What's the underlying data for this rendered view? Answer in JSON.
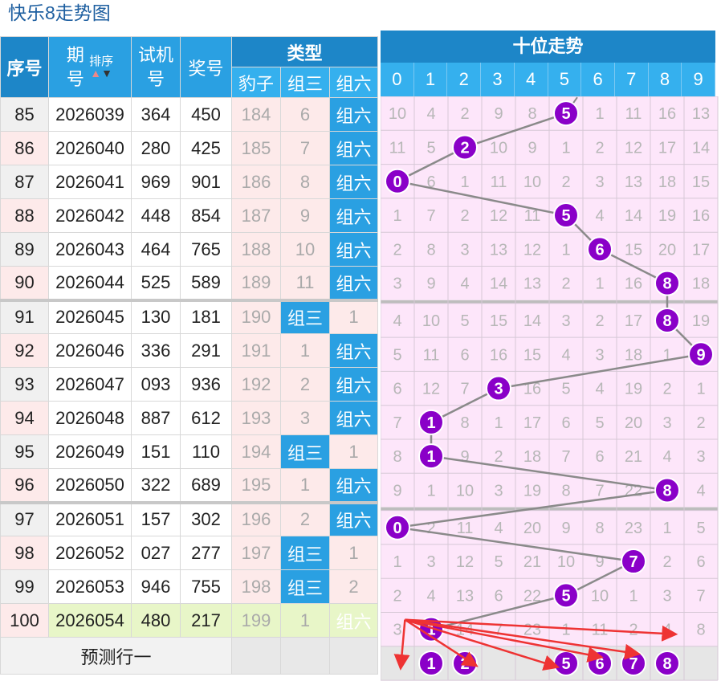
{
  "page": {
    "title": "快乐8走势图"
  },
  "left": {
    "headers": {
      "seq": "序号",
      "issue_a": "期",
      "issue_b": "号",
      "sort_label": "排序",
      "trial_a": "试机",
      "trial_b": "号",
      "prize": "奖号",
      "type": "类型",
      "leopard": "豹子",
      "group3": "组三",
      "group6": "组六"
    },
    "rows": [
      {
        "seq": "85",
        "issue": "2026039",
        "trial": "364",
        "prize": "450",
        "leopard": "184",
        "g3": "6",
        "g6": "组六",
        "tag": "g6",
        "sep": false
      },
      {
        "seq": "86",
        "issue": "2026040",
        "trial": "280",
        "prize": "425",
        "leopard": "185",
        "g3": "7",
        "g6": "组六",
        "tag": "g6",
        "sep": false
      },
      {
        "seq": "87",
        "issue": "2026041",
        "trial": "969",
        "prize": "901",
        "leopard": "186",
        "g3": "8",
        "g6": "组六",
        "tag": "g6",
        "sep": false
      },
      {
        "seq": "88",
        "issue": "2026042",
        "trial": "448",
        "prize": "854",
        "leopard": "187",
        "g3": "9",
        "g6": "组六",
        "tag": "g6",
        "sep": false
      },
      {
        "seq": "89",
        "issue": "2026043",
        "trial": "464",
        "prize": "765",
        "leopard": "188",
        "g3": "10",
        "g6": "组六",
        "tag": "g6",
        "sep": false
      },
      {
        "seq": "90",
        "issue": "2026044",
        "trial": "525",
        "prize": "589",
        "leopard": "189",
        "g3": "11",
        "g6": "组六",
        "tag": "g6",
        "sep": false
      },
      {
        "seq": "91",
        "issue": "2026045",
        "trial": "130",
        "prize": "181",
        "leopard": "190",
        "g3": "组三",
        "g6": "1",
        "tag": "g3",
        "sep": true
      },
      {
        "seq": "92",
        "issue": "2026046",
        "trial": "336",
        "prize": "291",
        "leopard": "191",
        "g3": "1",
        "g6": "组六",
        "tag": "g6",
        "sep": false
      },
      {
        "seq": "93",
        "issue": "2026047",
        "trial": "093",
        "prize": "936",
        "leopard": "192",
        "g3": "2",
        "g6": "组六",
        "tag": "g6",
        "sep": false
      },
      {
        "seq": "94",
        "issue": "2026048",
        "trial": "887",
        "prize": "612",
        "leopard": "193",
        "g3": "3",
        "g6": "组六",
        "tag": "g6",
        "sep": false
      },
      {
        "seq": "95",
        "issue": "2026049",
        "trial": "151",
        "prize": "110",
        "leopard": "194",
        "g3": "组三",
        "g6": "1",
        "tag": "g3",
        "sep": false
      },
      {
        "seq": "96",
        "issue": "2026050",
        "trial": "322",
        "prize": "689",
        "leopard": "195",
        "g3": "1",
        "g6": "组六",
        "tag": "g6",
        "sep": false
      },
      {
        "seq": "97",
        "issue": "2026051",
        "trial": "157",
        "prize": "302",
        "leopard": "196",
        "g3": "2",
        "g6": "组六",
        "tag": "g6",
        "sep": true
      },
      {
        "seq": "98",
        "issue": "2026052",
        "trial": "027",
        "prize": "277",
        "leopard": "197",
        "g3": "组三",
        "g6": "1",
        "tag": "g3",
        "sep": false
      },
      {
        "seq": "99",
        "issue": "2026053",
        "trial": "946",
        "prize": "755",
        "leopard": "198",
        "g3": "组三",
        "g6": "2",
        "tag": "g3",
        "sep": false
      },
      {
        "seq": "100",
        "issue": "2026054",
        "trial": "480",
        "prize": "217",
        "leopard": "199",
        "g3": "1",
        "g6": "组六",
        "tag": "g6",
        "sep": false
      }
    ],
    "predict_label": "预测行一"
  },
  "right": {
    "title": "十位走势",
    "columns": [
      "0",
      "1",
      "2",
      "3",
      "4",
      "5",
      "6",
      "7",
      "8",
      "9"
    ],
    "ball_color": "#8a00c8",
    "grid_rows": [
      [
        "10",
        "4",
        "2",
        "9",
        "8",
        "5",
        "1",
        "11",
        "16",
        "13"
      ],
      [
        "11",
        "5",
        "2",
        "10",
        "9",
        "1",
        "2",
        "12",
        "17",
        "14"
      ],
      [
        "0",
        "6",
        "1",
        "11",
        "10",
        "2",
        "3",
        "13",
        "18",
        "15"
      ],
      [
        "1",
        "7",
        "2",
        "12",
        "11",
        "5",
        "4",
        "14",
        "19",
        "16"
      ],
      [
        "2",
        "8",
        "3",
        "13",
        "12",
        "1",
        "6",
        "15",
        "20",
        "17"
      ],
      [
        "3",
        "9",
        "4",
        "14",
        "13",
        "2",
        "1",
        "16",
        "8",
        "18"
      ],
      [
        "4",
        "10",
        "5",
        "15",
        "14",
        "3",
        "2",
        "17",
        "8",
        "19"
      ],
      [
        "5",
        "11",
        "6",
        "16",
        "15",
        "4",
        "3",
        "18",
        "1",
        "9"
      ],
      [
        "6",
        "12",
        "7",
        "3",
        "16",
        "5",
        "4",
        "19",
        "2",
        "1"
      ],
      [
        "7",
        "1",
        "8",
        "1",
        "17",
        "6",
        "5",
        "20",
        "3",
        "2"
      ],
      [
        "8",
        "1",
        "9",
        "2",
        "18",
        "7",
        "6",
        "21",
        "4",
        "3"
      ],
      [
        "9",
        "1",
        "10",
        "3",
        "19",
        "8",
        "7",
        "22",
        "8",
        "4"
      ],
      [
        "0",
        "2",
        "11",
        "4",
        "20",
        "9",
        "8",
        "23",
        "1",
        "5"
      ],
      [
        "1",
        "3",
        "12",
        "5",
        "21",
        "10",
        "9",
        "7",
        "2",
        "6"
      ],
      [
        "2",
        "4",
        "13",
        "6",
        "22",
        "5",
        "10",
        "1",
        "3",
        "7"
      ],
      [
        "3",
        "1",
        "14",
        "7",
        "23",
        "1",
        "11",
        "2",
        "4",
        "8"
      ]
    ],
    "hits": [
      5,
      2,
      0,
      5,
      6,
      8,
      8,
      9,
      3,
      1,
      1,
      8,
      0,
      7,
      5,
      1
    ],
    "predict_balls": [
      "1",
      "2",
      "5",
      "6",
      "7",
      "8"
    ],
    "predict_cols": [
      1,
      2,
      5,
      6,
      7,
      8
    ],
    "arrow_color": "#ee3333"
  }
}
